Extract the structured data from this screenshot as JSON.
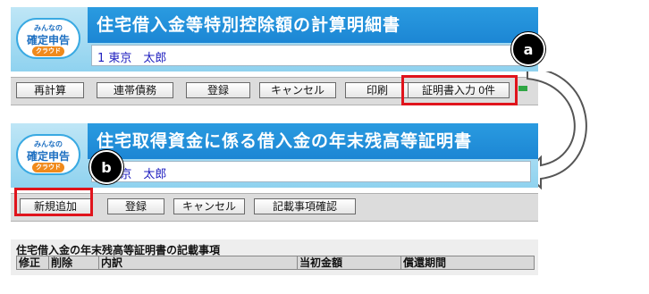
{
  "top": {
    "logo": {
      "line1": "みんなの",
      "line2": "確定申告",
      "line3": "クラウド"
    },
    "title": "住宅借入金等特別控除額の計算明細書",
    "name": "1 東京　太郎",
    "toolbar": {
      "recalc": "再計算",
      "joint": "連帯債務",
      "register": "登録",
      "cancel": "キャンセル",
      "print": "印刷",
      "cert_input": "証明書入力 0件"
    },
    "badge": "a"
  },
  "bottom": {
    "logo": {
      "line1": "みんなの",
      "line2": "確定申告",
      "line3": "クラウド"
    },
    "title": "住宅取得資金に係る借入金の年末残高等証明書",
    "name": "1 東京　太郎",
    "toolbar": {
      "new": "新規追加",
      "register": "登録",
      "cancel": "キャンセル",
      "confirm": "記載事項確認"
    },
    "badge": "b",
    "section_title": "住宅借入金の年末残高等証明書の記載事項",
    "columns": [
      "修正",
      "削除",
      "内訳",
      "当初金額",
      "償還期間"
    ]
  },
  "colors": {
    "title_band": "#1c86d4",
    "header_bg": "#8fd2ef",
    "highlight": "#e0141c",
    "name_text": "#1f1fbf"
  }
}
